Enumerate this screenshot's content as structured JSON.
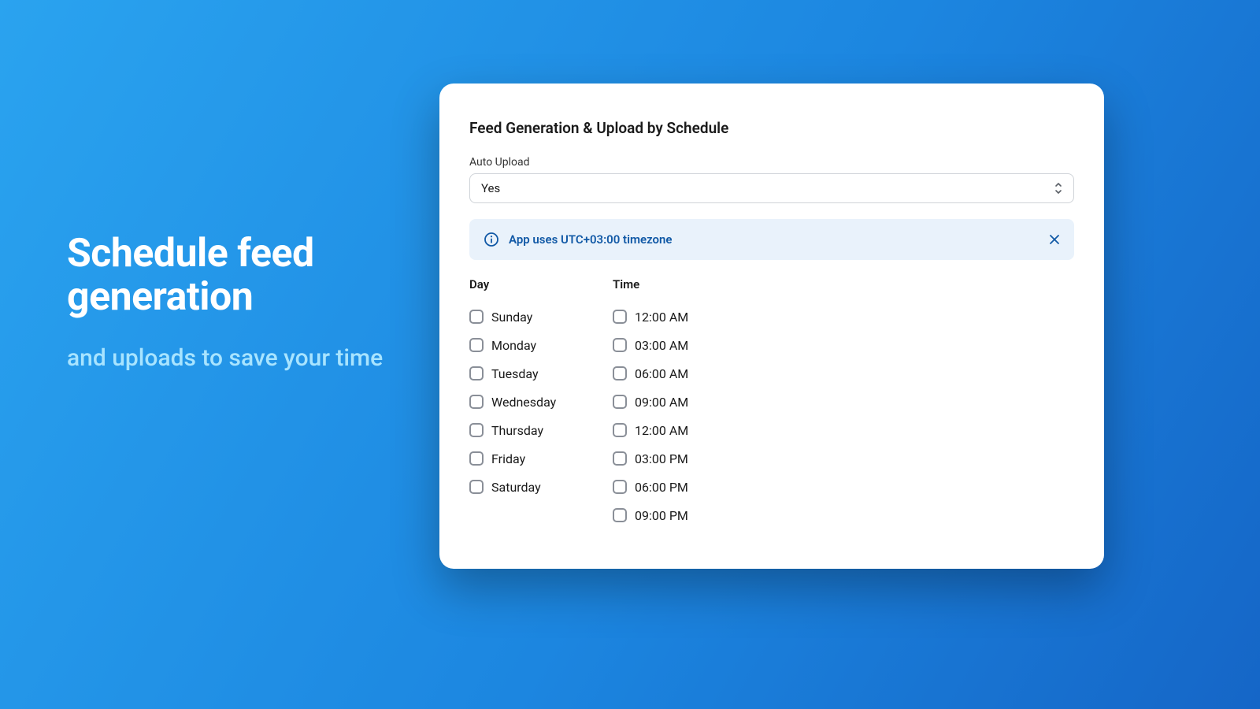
{
  "hero": {
    "title": "Schedule feed generation",
    "subtitle": "and uploads to save your time"
  },
  "card": {
    "title": "Feed Generation & Upload by Schedule",
    "auto_upload_label": "Auto Upload",
    "auto_upload_value": "Yes",
    "banner_text": "App uses UTC+03:00 timezone",
    "day_header": "Day",
    "time_header": "Time",
    "days": [
      {
        "label": "Sunday",
        "checked": false
      },
      {
        "label": "Monday",
        "checked": false
      },
      {
        "label": "Tuesday",
        "checked": false
      },
      {
        "label": "Wednesday",
        "checked": false
      },
      {
        "label": "Thursday",
        "checked": false
      },
      {
        "label": "Friday",
        "checked": false
      },
      {
        "label": "Saturday",
        "checked": false
      }
    ],
    "times": [
      {
        "label": "12:00 AM",
        "checked": false
      },
      {
        "label": "03:00 AM",
        "checked": false
      },
      {
        "label": "06:00 AM",
        "checked": false
      },
      {
        "label": "09:00 AM",
        "checked": false
      },
      {
        "label": "12:00 AM",
        "checked": false
      },
      {
        "label": "03:00 PM",
        "checked": false
      },
      {
        "label": "06:00 PM",
        "checked": false
      },
      {
        "label": "09:00 PM",
        "checked": false
      }
    ]
  }
}
